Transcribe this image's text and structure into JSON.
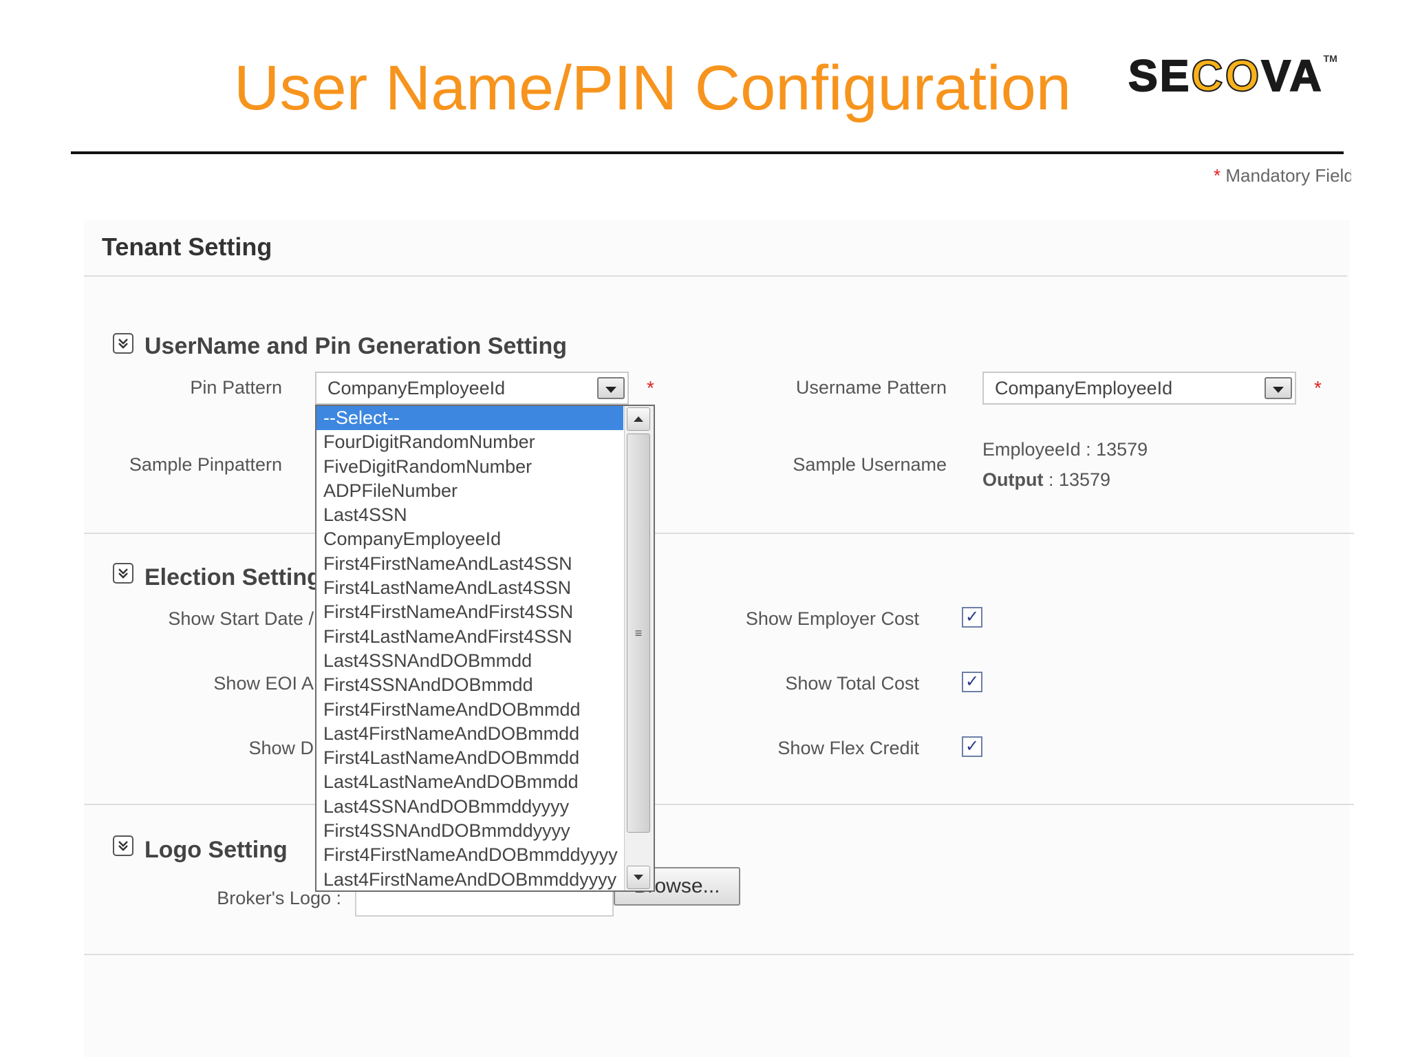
{
  "slide": {
    "title": "User Name/PIN Configuration"
  },
  "logo": {
    "part1": "SE",
    "part2": "CO",
    "part3": "VA",
    "tm": "TM"
  },
  "mandatory": {
    "star": "*",
    "text": "Mandatory Field"
  },
  "tenant": {
    "heading": "Tenant Setting"
  },
  "username_section": {
    "title": "UserName and Pin Generation Setting",
    "pin_pattern_label": "Pin Pattern",
    "pin_pattern_value": "CompanyEmployeeId",
    "username_pattern_label": "Username Pattern",
    "username_pattern_value": "CompanyEmployeeId",
    "required_star": "*",
    "sample_pin_label": "Sample Pinpattern",
    "sample_username_label": "Sample Username",
    "employee_id_label": "EmployeeId",
    "employee_id_sep": " : ",
    "employee_id_value": "13579",
    "output_label": "Output",
    "output_sep": " : ",
    "output_value": "13579"
  },
  "election_section": {
    "title": "Election Setting",
    "show_start_date_label": "Show Start Date /",
    "show_eoi_label": "Show EOI A",
    "show_d_label": "Show D",
    "show_employer_cost_label": "Show Employer Cost",
    "show_total_cost_label": "Show Total Cost",
    "show_flex_credit_label": "Show Flex Credit",
    "check_glyph": "✓"
  },
  "logo_section": {
    "title": "Logo Setting",
    "brokers_logo_label": "Broker's Logo :",
    "browse_label": "Browse..."
  },
  "pin_dropdown": {
    "selected_index": 0,
    "options": [
      "--Select--",
      "FourDigitRandomNumber",
      "FiveDigitRandomNumber",
      "ADPFileNumber",
      "Last4SSN",
      "CompanyEmployeeId",
      "First4FirstNameAndLast4SSN",
      "First4LastNameAndLast4SSN",
      "First4FirstNameAndFirst4SSN",
      "First4LastNameAndFirst4SSN",
      "Last4SSNAndDOBmmdd",
      "First4SSNAndDOBmmdd",
      "First4FirstNameAndDOBmmdd",
      "Last4FirstNameAndDOBmmdd",
      "First4LastNameAndDOBmmdd",
      "Last4LastNameAndDOBmmdd",
      "Last4SSNAndDOBmmddyyyy",
      "First4SSNAndDOBmmddyyyy",
      "First4FirstNameAndDOBmmddyyyy",
      "Last4FirstNameAndDOBmmddyyyy"
    ]
  },
  "icons": {
    "section_toggle": "chevron-double-down-icon",
    "grip": "scroll-grip-icon"
  },
  "colors": {
    "title_orange": "#f7941d",
    "logo_gold": "#f7b11b",
    "selected_blue": "#3d87e0",
    "required_red": "#e02020"
  }
}
